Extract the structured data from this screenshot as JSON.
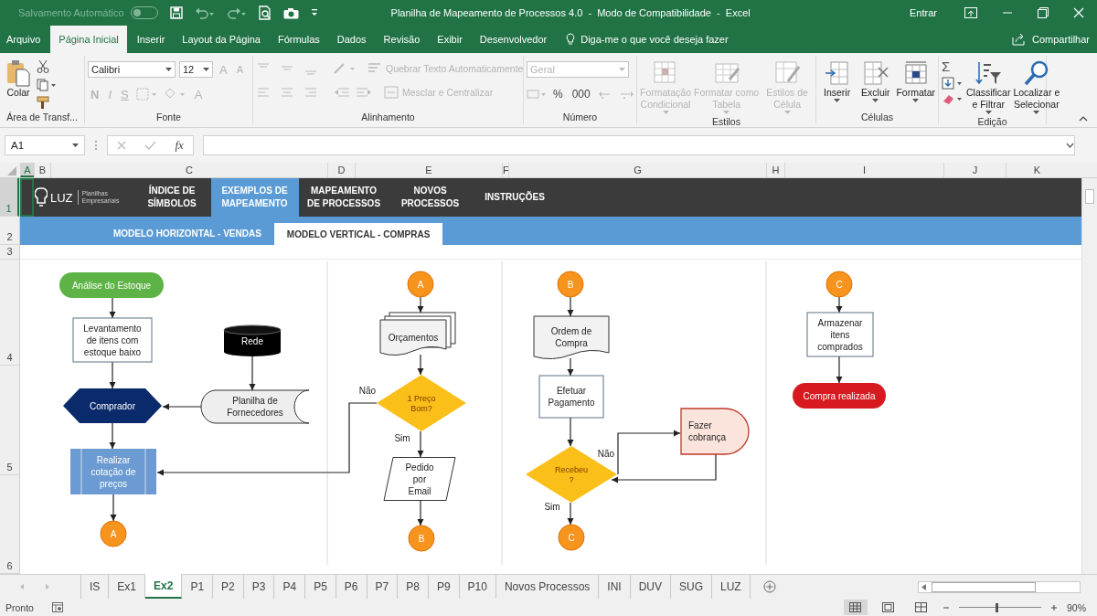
{
  "title_bar": {
    "autosave_label": "Salvamento Automático",
    "autosave_on": false,
    "title": "Planilha de Mapeamento de Processos 4.0  -  Modo de Compatibilidade  -  Excel",
    "sign_in": "Entrar"
  },
  "menu_tabs": [
    {
      "label": "Arquivo",
      "selected": false
    },
    {
      "label": "Página Inicial",
      "selected": true
    },
    {
      "label": "Inserir",
      "selected": false
    },
    {
      "label": "Layout da Página",
      "selected": false
    },
    {
      "label": "Fórmulas",
      "selected": false
    },
    {
      "label": "Dados",
      "selected": false
    },
    {
      "label": "Revisão",
      "selected": false
    },
    {
      "label": "Exibir",
      "selected": false
    },
    {
      "label": "Desenvolvedor",
      "selected": false
    }
  ],
  "tell_me": {
    "placeholder": "Diga-me o que você deseja fazer"
  },
  "share": "Compartilhar",
  "ribbon": [
    {
      "kind": "clipboard",
      "label": "Área de Transf...",
      "paste": "Colar"
    },
    {
      "kind": "font",
      "label": "Fonte",
      "font_name": "Calibri",
      "font_size": "12",
      "grow": "A",
      "shrink": "A",
      "styles": [
        {
          "label": "N",
          "disabled": true
        },
        {
          "label": "I",
          "disabled": true
        },
        {
          "label": "S",
          "disabled": true
        }
      ],
      "font_color_label": "A"
    },
    {
      "kind": "alignment",
      "label": "Alinhamento",
      "wrap": {
        "label": "Quebrar Texto Automaticamente",
        "disabled": true
      },
      "merge": {
        "label": "Mesclar e Centralizar",
        "disabled": true
      }
    },
    {
      "kind": "number",
      "label": "Número",
      "format": "Geral",
      "symbols": [
        "%",
        "000"
      ]
    },
    {
      "kind": "large",
      "label": "Estilos",
      "buttons": [
        {
          "kind": "conditional",
          "lines": [
            "Formatação",
            "Condicional"
          ],
          "disabled": true
        },
        {
          "kind": "table",
          "lines": [
            "Formatar como",
            "Tabela"
          ],
          "disabled": true
        },
        {
          "kind": "cellstyle",
          "lines": [
            "Estilos de",
            "Célula"
          ],
          "disabled": true
        }
      ]
    },
    {
      "kind": "large",
      "label": "Células",
      "buttons": [
        {
          "kind": "insert",
          "lines": [
            "Inserir"
          ],
          "disabled": false
        },
        {
          "kind": "delete",
          "lines": [
            "Excluir"
          ],
          "disabled": false
        },
        {
          "kind": "format",
          "lines": [
            "Formatar"
          ],
          "disabled": false
        }
      ]
    },
    {
      "kind": "editing",
      "label": "Edição",
      "sum": "Σ",
      "buttons": [
        {
          "kind": "sort",
          "lines": [
            "Classificar",
            "e Filtrar"
          ],
          "disabled": false
        },
        {
          "kind": "find",
          "lines": [
            "Localizar e",
            "Selecionar"
          ],
          "disabled": false
        }
      ]
    }
  ],
  "formula_bar": {
    "name_box": "A1",
    "function_label": "fx"
  },
  "columns": [
    {
      "label": "A",
      "selected": true
    },
    {
      "label": "B",
      "selected": false
    },
    {
      "label": "C",
      "selected": false
    },
    {
      "label": "D",
      "selected": false
    },
    {
      "label": "E",
      "selected": false
    },
    {
      "label": "F",
      "selected": false
    },
    {
      "label": "G",
      "selected": false
    },
    {
      "label": "H",
      "selected": false
    },
    {
      "label": "I",
      "selected": false
    },
    {
      "label": "J",
      "selected": false
    },
    {
      "label": "K",
      "selected": false
    }
  ],
  "rows": [
    {
      "label": "1",
      "selected": true
    },
    {
      "label": "2",
      "selected": false
    },
    {
      "label": "3",
      "selected": false
    },
    {
      "label": "4",
      "selected": false
    },
    {
      "label": "5",
      "selected": false
    },
    {
      "label": "6",
      "selected": false
    }
  ],
  "nav": {
    "logo": "LUZ",
    "tagline": "Planilhas Empresariais",
    "items": [
      {
        "lines": [
          "ÍNDICE DE",
          "SÍMBOLOS"
        ],
        "selected": false
      },
      {
        "lines": [
          "EXEMPLOS DE",
          "MAPEAMENTO"
        ],
        "selected": true
      },
      {
        "lines": [
          "MAPEAMENTO",
          "DE PROCESSOS"
        ],
        "selected": false
      },
      {
        "lines": [
          "NOVOS",
          "PROCESSOS"
        ],
        "selected": false
      },
      {
        "lines": [
          "INSTRUÇÕES"
        ],
        "selected": false
      }
    ],
    "subtabs": [
      {
        "label": "MODELO HORIZONTAL - VENDAS",
        "selected": false
      },
      {
        "label": "MODELO VERTICAL - COMPRAS",
        "selected": true
      }
    ]
  },
  "flowchart": {
    "nodes": [
      {
        "kind": "terminator",
        "lines": [
          "Análise do Estoque"
        ],
        "color": "#5db346"
      },
      {
        "kind": "process",
        "lines": [
          "Levantamento",
          "de itens com",
          "estoque baixo"
        ]
      },
      {
        "kind": "database",
        "lines": [
          "Rede"
        ]
      },
      {
        "kind": "hexagon",
        "lines": [
          "Comprador"
        ]
      },
      {
        "kind": "stored_data",
        "lines": [
          "Planilha de",
          "Fornecedores"
        ]
      },
      {
        "kind": "predefined",
        "lines": [
          "Realizar",
          "cotação de",
          "preços"
        ]
      },
      {
        "kind": "connector",
        "lines": [
          "A"
        ]
      },
      {
        "kind": "connector",
        "lines": [
          "A"
        ]
      },
      {
        "kind": "multi_document",
        "lines": [
          "Orçamentos"
        ]
      },
      {
        "kind": "decision",
        "lines": [
          "1 Preço",
          "Bom?"
        ]
      },
      {
        "kind": "data",
        "lines": [
          "Pedido",
          "por",
          "Email"
        ]
      },
      {
        "kind": "connector",
        "lines": [
          "B"
        ]
      },
      {
        "kind": "connector",
        "lines": [
          "B"
        ]
      },
      {
        "kind": "document",
        "lines": [
          "Ordem de",
          "Compra"
        ]
      },
      {
        "kind": "process",
        "lines": [
          "Efetuar",
          "Pagamento"
        ]
      },
      {
        "kind": "delay",
        "lines": [
          "Fazer",
          "cobrança"
        ]
      },
      {
        "kind": "decision",
        "lines": [
          "Recebeu",
          "?"
        ]
      },
      {
        "kind": "connector",
        "lines": [
          "C"
        ]
      },
      {
        "kind": "connector",
        "lines": [
          "C"
        ]
      },
      {
        "kind": "process",
        "lines": [
          "Armazenar",
          "itens",
          "comprados"
        ]
      },
      {
        "kind": "terminator",
        "lines": [
          "Compra realizada"
        ],
        "color": "#d71920"
      }
    ],
    "edge_labels": [
      "Não",
      "Sim",
      "Não",
      "Sim"
    ]
  },
  "sheet_tabs": [
    {
      "label": "IS",
      "selected": false
    },
    {
      "label": "Ex1",
      "selected": false
    },
    {
      "label": "Ex2",
      "selected": true
    },
    {
      "label": "P1",
      "selected": false
    },
    {
      "label": "P2",
      "selected": false
    },
    {
      "label": "P3",
      "selected": false
    },
    {
      "label": "P4",
      "selected": false
    },
    {
      "label": "P5",
      "selected": false
    },
    {
      "label": "P6",
      "selected": false
    },
    {
      "label": "P7",
      "selected": false
    },
    {
      "label": "P8",
      "selected": false
    },
    {
      "label": "P9",
      "selected": false
    },
    {
      "label": "P10",
      "selected": false
    },
    {
      "label": "Novos Processos",
      "selected": false
    },
    {
      "label": "INI",
      "selected": false
    },
    {
      "label": "DUV",
      "selected": false
    },
    {
      "label": "SUG",
      "selected": false
    },
    {
      "label": "LUZ",
      "selected": false
    }
  ],
  "status_bar": {
    "status": "Pronto",
    "views": [
      {
        "kind": "normal",
        "selected": true
      },
      {
        "kind": "page_layout",
        "selected": false
      },
      {
        "kind": "page_break",
        "selected": false
      }
    ],
    "zoom_slider": {
      "level": 0.45
    },
    "zoom": "90%"
  }
}
